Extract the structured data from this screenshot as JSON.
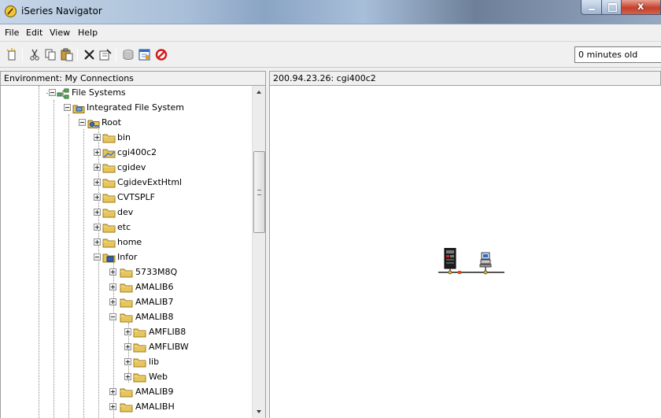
{
  "window": {
    "title": "iSeries Navigator",
    "close_glyph": "x"
  },
  "menu": {
    "items": [
      "File",
      "Edit",
      "View",
      "Help"
    ]
  },
  "toolbar": {
    "buttons": [
      "new-icon",
      "cut-icon",
      "copy-icon",
      "paste-icon",
      "delete-icon",
      "properties-icon",
      "database-icon",
      "task-pad-icon",
      "stop-icon"
    ],
    "status": "0 minutes old"
  },
  "left_panel": {
    "header": "Environment: My Connections"
  },
  "right_panel": {
    "header": "200.94.23.26:  cgi400c2"
  },
  "tree": {
    "file_systems": "File Systems",
    "integrated_file_system": "Integrated File System",
    "root": "Root",
    "root_children": [
      "bin",
      "cgi400c2",
      "cgidev",
      "CgidevExtHtml",
      "CVTSPLF",
      "dev",
      "etc",
      "home",
      "Infor"
    ],
    "infor_children": [
      "5733M8Q",
      "AMALIB6",
      "AMALIB7",
      "AMALIB8"
    ],
    "amalib8_children": [
      "AMFLIB8",
      "AMFLIBW",
      "lib",
      "Web"
    ],
    "infor_more": [
      "AMALIB9",
      "AMALIBH"
    ]
  },
  "colors": {
    "folder": "#e6c65a",
    "selection": "#3399ff"
  }
}
